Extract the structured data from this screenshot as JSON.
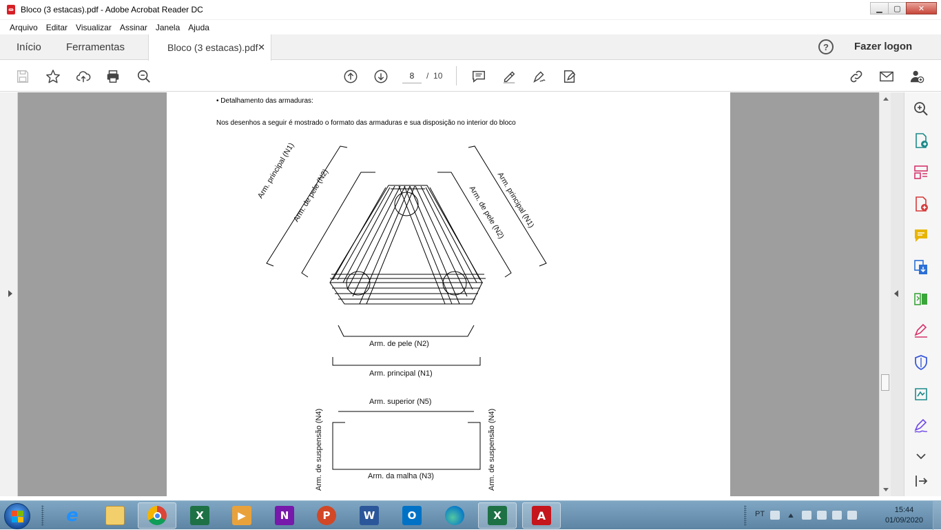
{
  "window": {
    "title": "Bloco (3 estacas).pdf - Adobe Acrobat Reader DC"
  },
  "menu": [
    "Arquivo",
    "Editar",
    "Visualizar",
    "Assinar",
    "Janela",
    "Ajuda"
  ],
  "tabs": {
    "home": "Início",
    "tools": "Ferramentas",
    "document": "Bloco (3 estacas).pdf"
  },
  "header": {
    "login": "Fazer logon"
  },
  "toolbar": {
    "current_page": "8",
    "page_separator": "/",
    "total_pages": "10"
  },
  "page": {
    "bullet": "• Detalhamento das armaduras:",
    "paragraph": "Nos desenhos a seguir é mostrado o formato das armaduras e sua disposição no interior do bloco",
    "labels": {
      "principal_left": "Arm. principal (N1)",
      "pele_left": "Arm. de pele (N2)",
      "principal_right": "Arm. principal (N1)",
      "pele_right": "Arm. de pele (N2)",
      "pele_bottom": "Arm. de pele (N2)",
      "principal_bottom": "Arm. principal (N1)",
      "superior": "Arm. superior (N5)",
      "suspensao_left": "Arm. de suspensão (N4)",
      "suspensao_right": "Arm. de suspensão (N4)",
      "malha": "Arm. da malha (N3)"
    }
  },
  "taskbar": {
    "language": "PT",
    "time": "15:44",
    "date": "01/09/2020"
  }
}
